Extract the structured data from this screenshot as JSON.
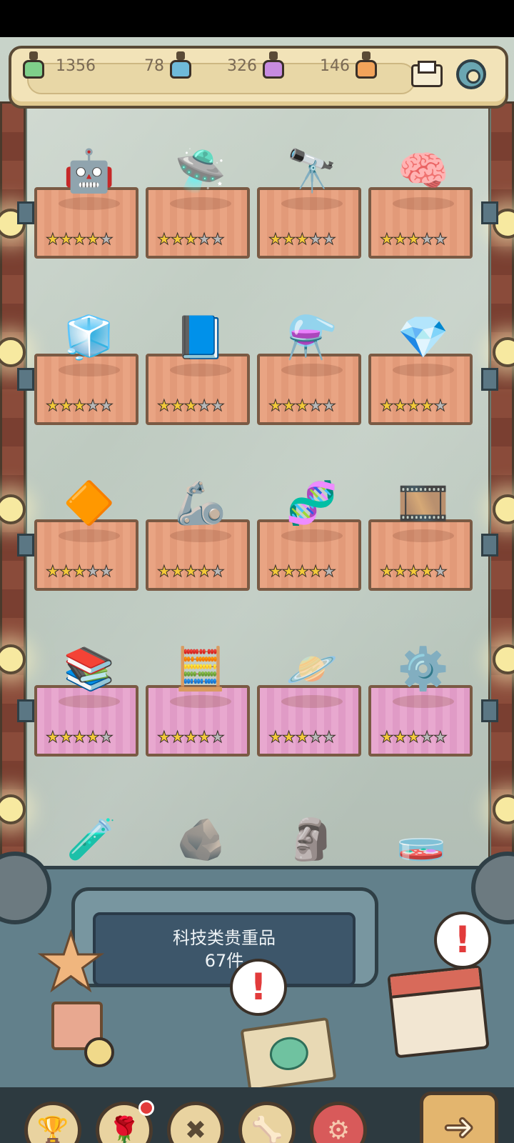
{
  "resources": [
    {
      "name": "green-flask-icon",
      "value": "1356",
      "color": "#7fcf8a"
    },
    {
      "name": "blue-flask-icon",
      "value": "78",
      "color": "#6fbad9"
    },
    {
      "name": "purple-flask-icon",
      "value": "326",
      "color": "#c78be0"
    },
    {
      "name": "orange-flask-icon",
      "value": "146",
      "color": "#f2a35a"
    }
  ],
  "header_icons": {
    "mail": "mail-icon",
    "settings": "gear-icon"
  },
  "shelves": [
    {
      "items": [
        {
          "name": "robot-toy",
          "glyph": "🤖",
          "stars": 4
        },
        {
          "name": "claw-device",
          "glyph": "🛸",
          "stars": 3
        },
        {
          "name": "space-telescope",
          "glyph": "🔭",
          "stars": 3
        },
        {
          "name": "brain",
          "glyph": "🧠",
          "stars": 3
        }
      ],
      "style": "orange"
    },
    {
      "items": [
        {
          "name": "rubiks-cube",
          "glyph": "🧊",
          "stars": 3
        },
        {
          "name": "scientist-book",
          "glyph": "📘",
          "stars": 3
        },
        {
          "name": "lab-apparatus",
          "glyph": "⚗️",
          "stars": 3
        },
        {
          "name": "green-crystal",
          "glyph": "💎",
          "stars": 4
        }
      ],
      "style": "orange"
    },
    {
      "items": [
        {
          "name": "golden-crystal",
          "glyph": "🔶",
          "stars": 3
        },
        {
          "name": "mini-robot",
          "glyph": "🦾",
          "stars": 4
        },
        {
          "name": "dna-model",
          "glyph": "🧬",
          "stars": 4
        },
        {
          "name": "film-projector",
          "glyph": "🎞️",
          "stars": 4
        }
      ],
      "style": "orange"
    },
    {
      "items": [
        {
          "name": "ancient-tome",
          "glyph": "📚",
          "stars": 4
        },
        {
          "name": "abacus-machine",
          "glyph": "🧮",
          "stars": 4
        },
        {
          "name": "planet-device",
          "glyph": "🪐",
          "stars": 3
        },
        {
          "name": "brass-engine",
          "glyph": "⚙️",
          "stars": 3
        }
      ],
      "style": "pink"
    }
  ],
  "partial_row": [
    "🧪",
    "🪨",
    "🗿",
    "🧫"
  ],
  "collection_panel": {
    "line1": "科技类贵重品",
    "line2": "67件"
  },
  "alert_symbol": "!",
  "nav": [
    {
      "name": "trophy-nav-button",
      "glyph": "🏆"
    },
    {
      "name": "rose-nav-button",
      "glyph": "🌹",
      "badge": true
    },
    {
      "name": "tools-nav-button",
      "glyph": "✖"
    },
    {
      "name": "fossil-nav-button",
      "glyph": "🦴"
    },
    {
      "name": "gear-nav-button",
      "glyph": "⚙",
      "active": true
    }
  ],
  "next_button": {
    "glyph": "➜"
  }
}
